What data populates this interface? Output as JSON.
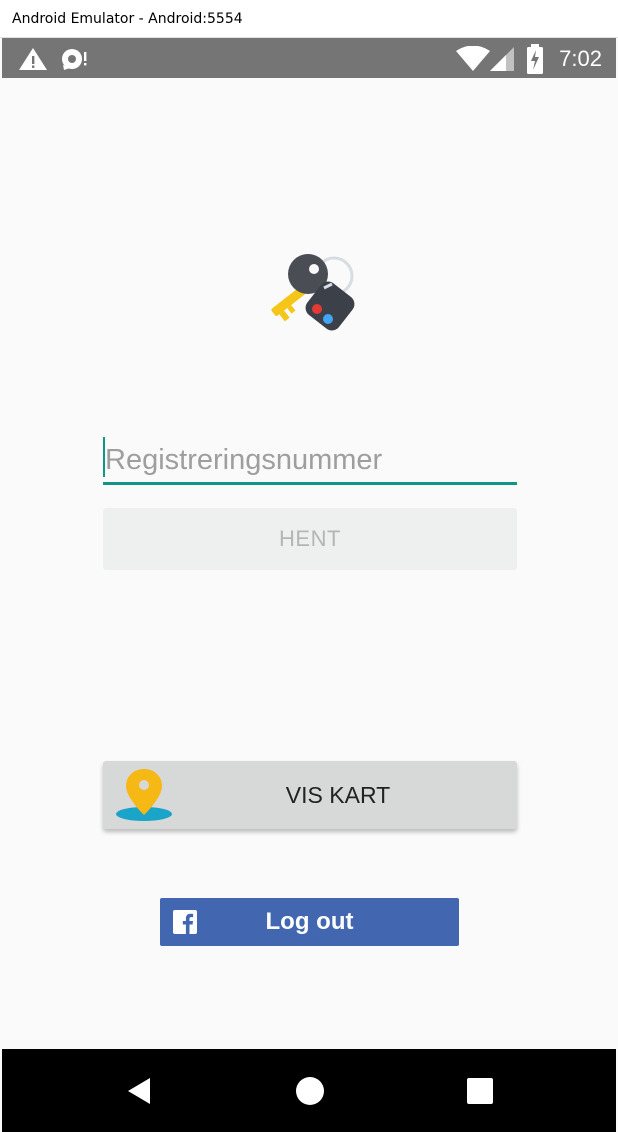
{
  "window": {
    "title": "Android Emulator - Android:5554"
  },
  "status_bar": {
    "time": "7:02",
    "icons": [
      "warning-icon",
      "sync-icon",
      "wifi-icon",
      "cell-signal-icon",
      "battery-charging-icon"
    ]
  },
  "app": {
    "logo_icon": "car-keys-icon",
    "registration": {
      "placeholder": "Registreringsnummer",
      "value": ""
    },
    "hent_label": "HENT",
    "vis_kart_label": "VIS KART",
    "logout_label": "Log out"
  },
  "navigation": {
    "buttons": [
      "back-icon",
      "home-icon",
      "recents-icon"
    ]
  },
  "colors": {
    "accent": "#0f9688",
    "facebook": "#4366b0",
    "status_bar": "#757575"
  }
}
